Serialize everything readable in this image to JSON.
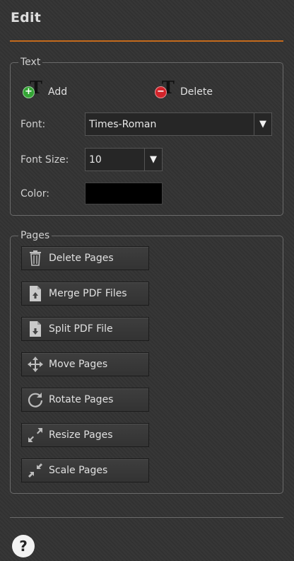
{
  "panel": {
    "title": "Edit"
  },
  "text_group": {
    "legend": "Text",
    "add_label": "Add",
    "delete_label": "Delete",
    "font_label": "Font:",
    "font_value": "Times-Roman",
    "size_label": "Font Size:",
    "size_value": "10",
    "color_label": "Color:",
    "color_value": "#000000"
  },
  "pages_group": {
    "legend": "Pages",
    "buttons": [
      {
        "label": "Delete Pages",
        "icon": "trash-icon"
      },
      {
        "label": "Merge PDF Files",
        "icon": "merge-file-icon"
      },
      {
        "label": "Split PDF File",
        "icon": "split-file-icon"
      },
      {
        "label": "Move Pages",
        "icon": "move-arrows-icon"
      },
      {
        "label": "Rotate Pages",
        "icon": "rotate-icon"
      },
      {
        "label": "Resize Pages",
        "icon": "resize-icon"
      },
      {
        "label": "Scale Pages",
        "icon": "scale-icon"
      }
    ]
  },
  "help": {
    "label": "?"
  },
  "colors": {
    "accent": "#c46a1c",
    "background": "#333333",
    "add_badge": "#33a534",
    "delete_badge": "#d3232a"
  }
}
